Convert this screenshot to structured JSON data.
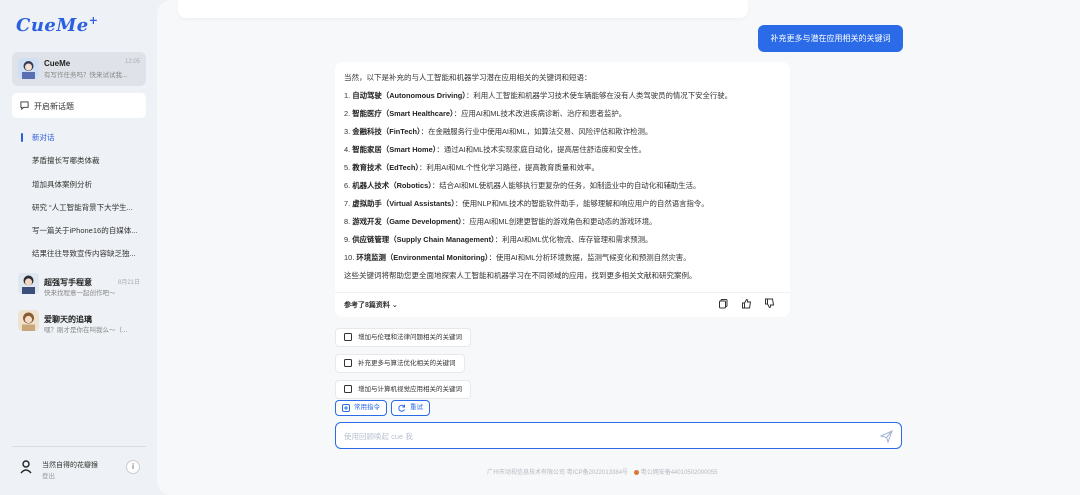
{
  "app": {
    "logo": "CueMe",
    "logo_mark": "+"
  },
  "sidebar": {
    "active_bot": {
      "name": "CueMe",
      "subtitle": "有写作任务吗？快来试试我...",
      "time": "12:05"
    },
    "new_chat_label": "开启新话题",
    "conversations": [
      {
        "label": "新对话",
        "active": true
      },
      {
        "label": "茅盾擅长写哪类体裁",
        "active": false
      },
      {
        "label": "增加具体案例分析",
        "active": false
      },
      {
        "label": "研究 “人工智能背景下大学生...",
        "active": false
      },
      {
        "label": "写一篇关于iPhone16的自媒体...",
        "active": false
      },
      {
        "label": "结果往往导致宣传内容缺乏独...",
        "active": false
      }
    ],
    "bots": [
      {
        "name": "超强写手程意",
        "subtitle": "快来找程意一起创作吧～",
        "time": "8月21日"
      },
      {
        "name": "爱聊天的追璃",
        "subtitle": "嘿？刚才是你在叫我么～（...",
        "time": ""
      }
    ],
    "user": {
      "name": "当然自得的花瓣猴",
      "logout": "登出",
      "info_icon": "i"
    }
  },
  "chat": {
    "user_message": "补充更多与潜在应用相关的关键词",
    "answer": {
      "intro": "当然，以下是补充的与人工智能和机器学习潜在应用相关的关键词和短语：",
      "items": [
        {
          "num": "1.",
          "term": "自动驾驶（Autonomous Driving）",
          "desc": "：利用人工智能和机器学习技术使车辆能够在没有人类驾驶员的情况下安全行驶。"
        },
        {
          "num": "2.",
          "term": "智能医疗（Smart Healthcare）",
          "desc": "：应用AI和ML技术改进疾病诊断、治疗和患者监护。"
        },
        {
          "num": "3.",
          "term": "金融科技（FinTech）",
          "desc": "：在金融服务行业中使用AI和ML，如算法交易、风险评估和欺诈检测。"
        },
        {
          "num": "4.",
          "term": "智能家居（Smart Home）",
          "desc": "：通过AI和ML技术实现家庭自动化，提高居住舒适度和安全性。"
        },
        {
          "num": "5.",
          "term": "教育技术（EdTech）",
          "desc": "：利用AI和ML个性化学习路径，提高教育质量和效率。"
        },
        {
          "num": "6.",
          "term": "机器人技术（Robotics）",
          "desc": "：结合AI和ML使机器人能够执行更复杂的任务，如制造业中的自动化和辅助生活。"
        },
        {
          "num": "7.",
          "term": "虚拟助手（Virtual Assistants）",
          "desc": "：使用NLP和ML技术的智能软件助手，能够理解和响应用户的自然语言指令。"
        },
        {
          "num": "8.",
          "term": "游戏开发（Game Development）",
          "desc": "：应用AI和ML创建更智能的游戏角色和更动态的游戏环境。"
        },
        {
          "num": "9.",
          "term": "供应链管理（Supply Chain Management）",
          "desc": "：利用AI和ML优化物流、库存管理和需求预测。"
        },
        {
          "num": "10.",
          "term": "环境监测（Environmental Monitoring）",
          "desc": "：使用AI和ML分析环境数据，监测气候变化和预测自然灾害。"
        }
      ],
      "outro": "这些关键词将帮助您更全面地探索人工智能和机器学习在不同领域的应用，找到更多相关文献和研究案例。",
      "refs_label": "参考了8篇资料"
    },
    "suggestions": [
      "增加与伦理和法律问题相关的关键词",
      "补充更多与算法优化相关的关键词",
      "增加与计算机视觉应用相关的关键词"
    ],
    "tools": {
      "common": "常用指令",
      "retry": "重试"
    },
    "input": {
      "placeholder": "使用回顾唤起 cue 我",
      "value": ""
    }
  },
  "footer": {
    "icp": "广州市动视信息技术有限公司 粤ICP备2022013384号",
    "police": "粤公网安备44010502000055"
  },
  "colors": {
    "accent": "#2b6be8",
    "sidebar_bg": "#eef1f5",
    "main_bg": "#f7f8fa"
  }
}
